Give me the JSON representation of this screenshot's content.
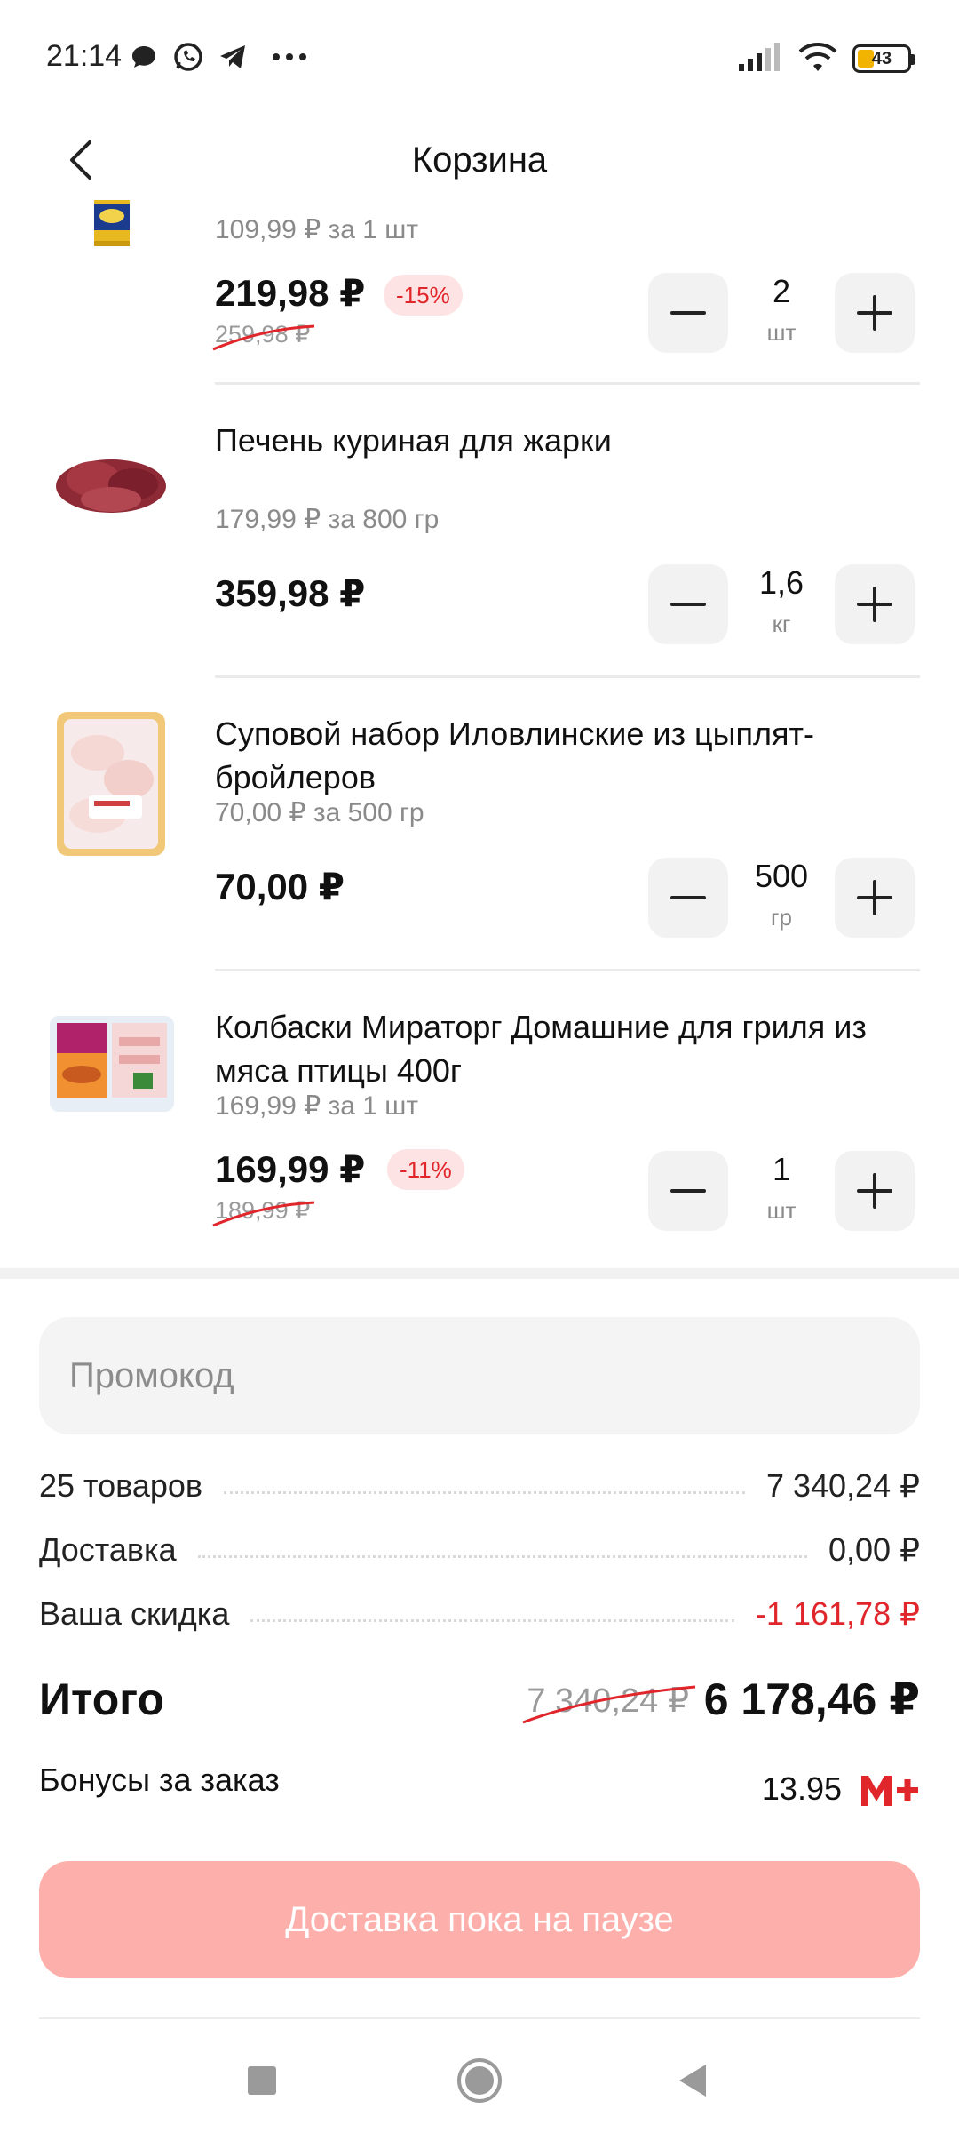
{
  "status_bar": {
    "time": "21:14",
    "battery_level": "43",
    "notification_icons": [
      "message-icon",
      "whatsapp-icon",
      "telegram-icon",
      "more-dots-icon"
    ],
    "system_icons": [
      "signal-icon",
      "wifi-icon",
      "battery-icon"
    ]
  },
  "header": {
    "title": "Корзина"
  },
  "cart": {
    "items": [
      {
        "title": "",
        "unit_price": "109,99 ₽ за 1 шт",
        "price": "219,98 ₽",
        "old_price": "259,98 ₽",
        "discount": "-15%",
        "qty_value": "2",
        "qty_unit": "шт"
      },
      {
        "title": "Печень куриная для жарки",
        "unit_price": "179,99 ₽ за 800 гр",
        "price": "359,98 ₽",
        "qty_value": "1,6",
        "qty_unit": "кг"
      },
      {
        "title": "Суповой набор Иловлинские из цыплят-бройлеров",
        "unit_price": "70,00 ₽ за 500 гр",
        "price": "70,00 ₽",
        "qty_value": "500",
        "qty_unit": "гр"
      },
      {
        "title": "Колбаски Мираторг Домашние для гриля из мяса птицы 400г",
        "unit_price": "169,99 ₽ за 1 шт",
        "price": "169,99 ₽",
        "old_price": "189,99 ₽",
        "discount": "-11%",
        "qty_value": "1",
        "qty_unit": "шт"
      }
    ]
  },
  "promo": {
    "placeholder": "Промокод",
    "value": ""
  },
  "summary": {
    "items_label": "25 товаров",
    "items_value": "7 340,24 ₽",
    "delivery_label": "Доставка",
    "delivery_value": "0,00 ₽",
    "discount_label": "Ваша скидка",
    "discount_value": "-1 161,78 ₽",
    "total_label": "Итого",
    "total_old": "7 340,24 ₽",
    "total_new": "6 178,46 ₽",
    "bonus_label": "Бонусы за заказ",
    "bonus_value": "13.95"
  },
  "checkout_button": {
    "label": "Доставка пока на паузе"
  },
  "colors": {
    "accent_red": "#e0262b",
    "cta_disabled": "#fdb0ab",
    "badge_bg": "#fde3e3"
  },
  "nav_bar": {
    "icons": [
      "recent-apps-icon",
      "home-icon",
      "back-icon"
    ]
  }
}
